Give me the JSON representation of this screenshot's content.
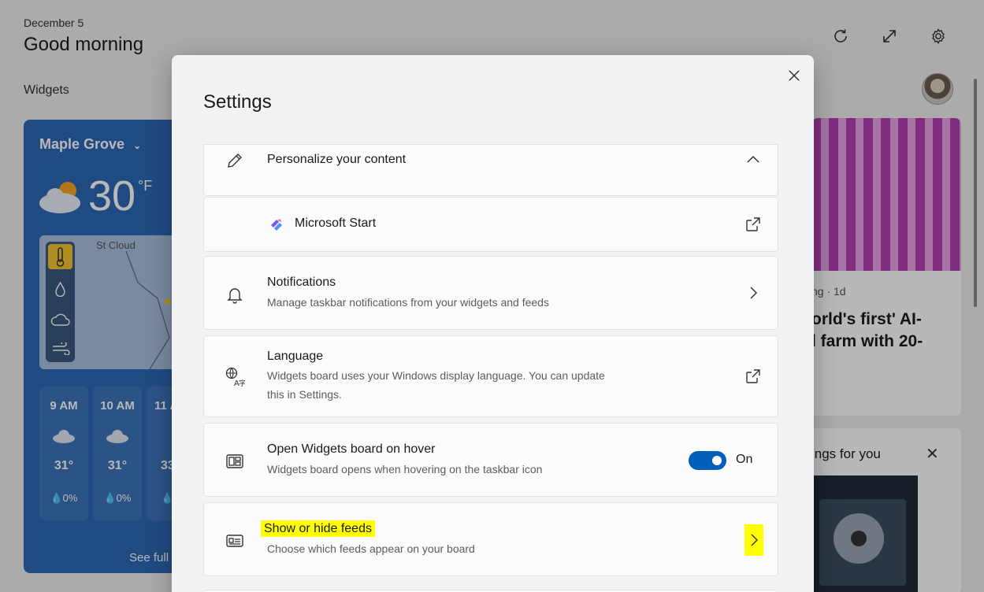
{
  "board": {
    "date": "December 5",
    "greeting": "Good morning",
    "widgets_label": "Widgets",
    "weather": {
      "location": "Maple Grove",
      "temperature": "30",
      "unit": "°F",
      "map_city": "St Cloud",
      "hours": [
        {
          "time": "9 AM",
          "temp": "31°",
          "precip": "💧0%"
        },
        {
          "time": "10 AM",
          "temp": "31°",
          "precip": "💧0%"
        },
        {
          "time": "11 A",
          "temp": "33",
          "precip": "💧"
        }
      ],
      "see_full": "See full"
    },
    "news": {
      "meta": "ng · 1d",
      "headline": "orld's first' AI-\nl farm with 20-"
    },
    "promo": {
      "title": "ings for you"
    }
  },
  "settings": {
    "title": "Settings",
    "items": {
      "personalize": {
        "label": "Personalize your content"
      },
      "microsoft_start": {
        "label": "Microsoft Start"
      },
      "notifications": {
        "label": "Notifications",
        "desc": "Manage taskbar notifications from your widgets and feeds"
      },
      "language": {
        "label": "Language",
        "desc": "Widgets board uses your Windows display language. You can update this in Settings."
      },
      "hover": {
        "label": "Open Widgets board on hover",
        "desc": "Widgets board opens when hovering on the taskbar icon",
        "toggle_state": "On"
      },
      "feeds": {
        "label": "Show or hide feeds",
        "desc": "Choose which feeds appear on your board"
      }
    }
  },
  "colors": {
    "accent": "#005fb8",
    "highlight": "#ffff00",
    "weather_bg": "#2d69b5"
  }
}
